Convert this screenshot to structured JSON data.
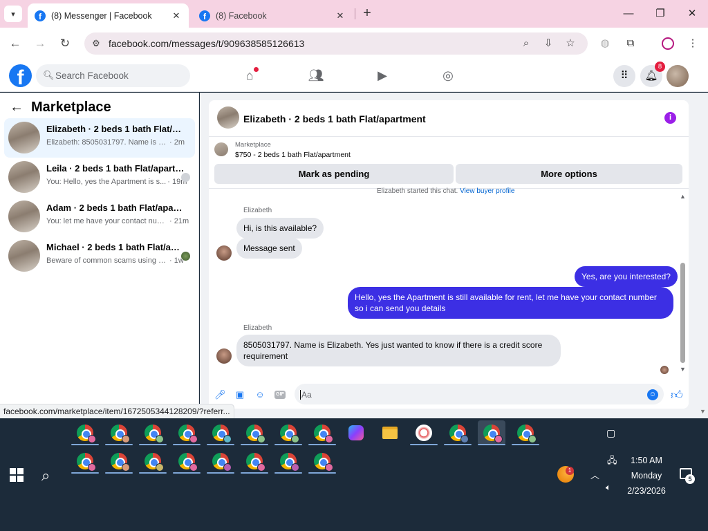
{
  "browser": {
    "tabs": [
      {
        "title": "(8) Messenger | Facebook",
        "active": true
      },
      {
        "title": "(8) Facebook",
        "active": false
      }
    ],
    "url": "facebook.com/messages/t/909638585126613",
    "status_url": "facebook.com/marketplace/item/1672505344128209/?referr..."
  },
  "fb_header": {
    "search_placeholder": "Search Facebook",
    "notification_count": "8",
    "brand_color": "#1877f2"
  },
  "sidebar": {
    "title": "Marketplace",
    "conversations": [
      {
        "name": "Elizabeth · 2 beds 1 bath Flat/apart...",
        "snippet": "Elizabeth: 8505031797. Name is Eliza...",
        "time": "· 2m",
        "active": true
      },
      {
        "name": "Leila · 2 beds 1 bath Flat/apartm...",
        "snippet": "You: Hello, yes the Apartment is s...",
        "time": "· 19m",
        "active": false
      },
      {
        "name": "Adam · 2 beds 1 bath Flat/apartme...",
        "snippet": "You: let me have your contact numb...",
        "time": "· 21m",
        "active": false
      },
      {
        "name": "Michael · 2 beds 1 bath Flat/apa...",
        "snippet": "Beware of common scams using p...",
        "time": "· 1w",
        "active": false
      }
    ]
  },
  "chat": {
    "title": "Elizabeth · 2 beds 1 bath Flat/apartment",
    "listing_label": "Marketplace",
    "listing_price": "$750 - 2 beds 1 bath Flat/apartment",
    "mark_pending_label": "Mark as pending",
    "more_options_label": "More options",
    "started_text": "Elizabeth started this chat.",
    "view_buyer_label": "View buyer profile",
    "messages": [
      {
        "sender": "Elizabeth",
        "text": "Hi, is this available?",
        "direction": "in"
      },
      {
        "text": "Message sent",
        "direction": "in"
      },
      {
        "text": "Yes, are you interested?",
        "direction": "out"
      },
      {
        "text": "Hello, yes the Apartment is still available for rent, let me have your contact number so i can send you details",
        "direction": "out"
      },
      {
        "sender": "Elizabeth",
        "text": "8505031797. Name is Elizabeth. Yes just wanted to know if there is a credit score requirement",
        "direction": "in"
      }
    ],
    "composer_placeholder": "Aa",
    "gif_label": "GIF",
    "outgoing_color": "#3c2fe4"
  },
  "taskbar": {
    "time": "1:50 AM",
    "day": "Monday",
    "date": "2/23/2026",
    "weather_badge": "1",
    "notification_badge": "5"
  }
}
